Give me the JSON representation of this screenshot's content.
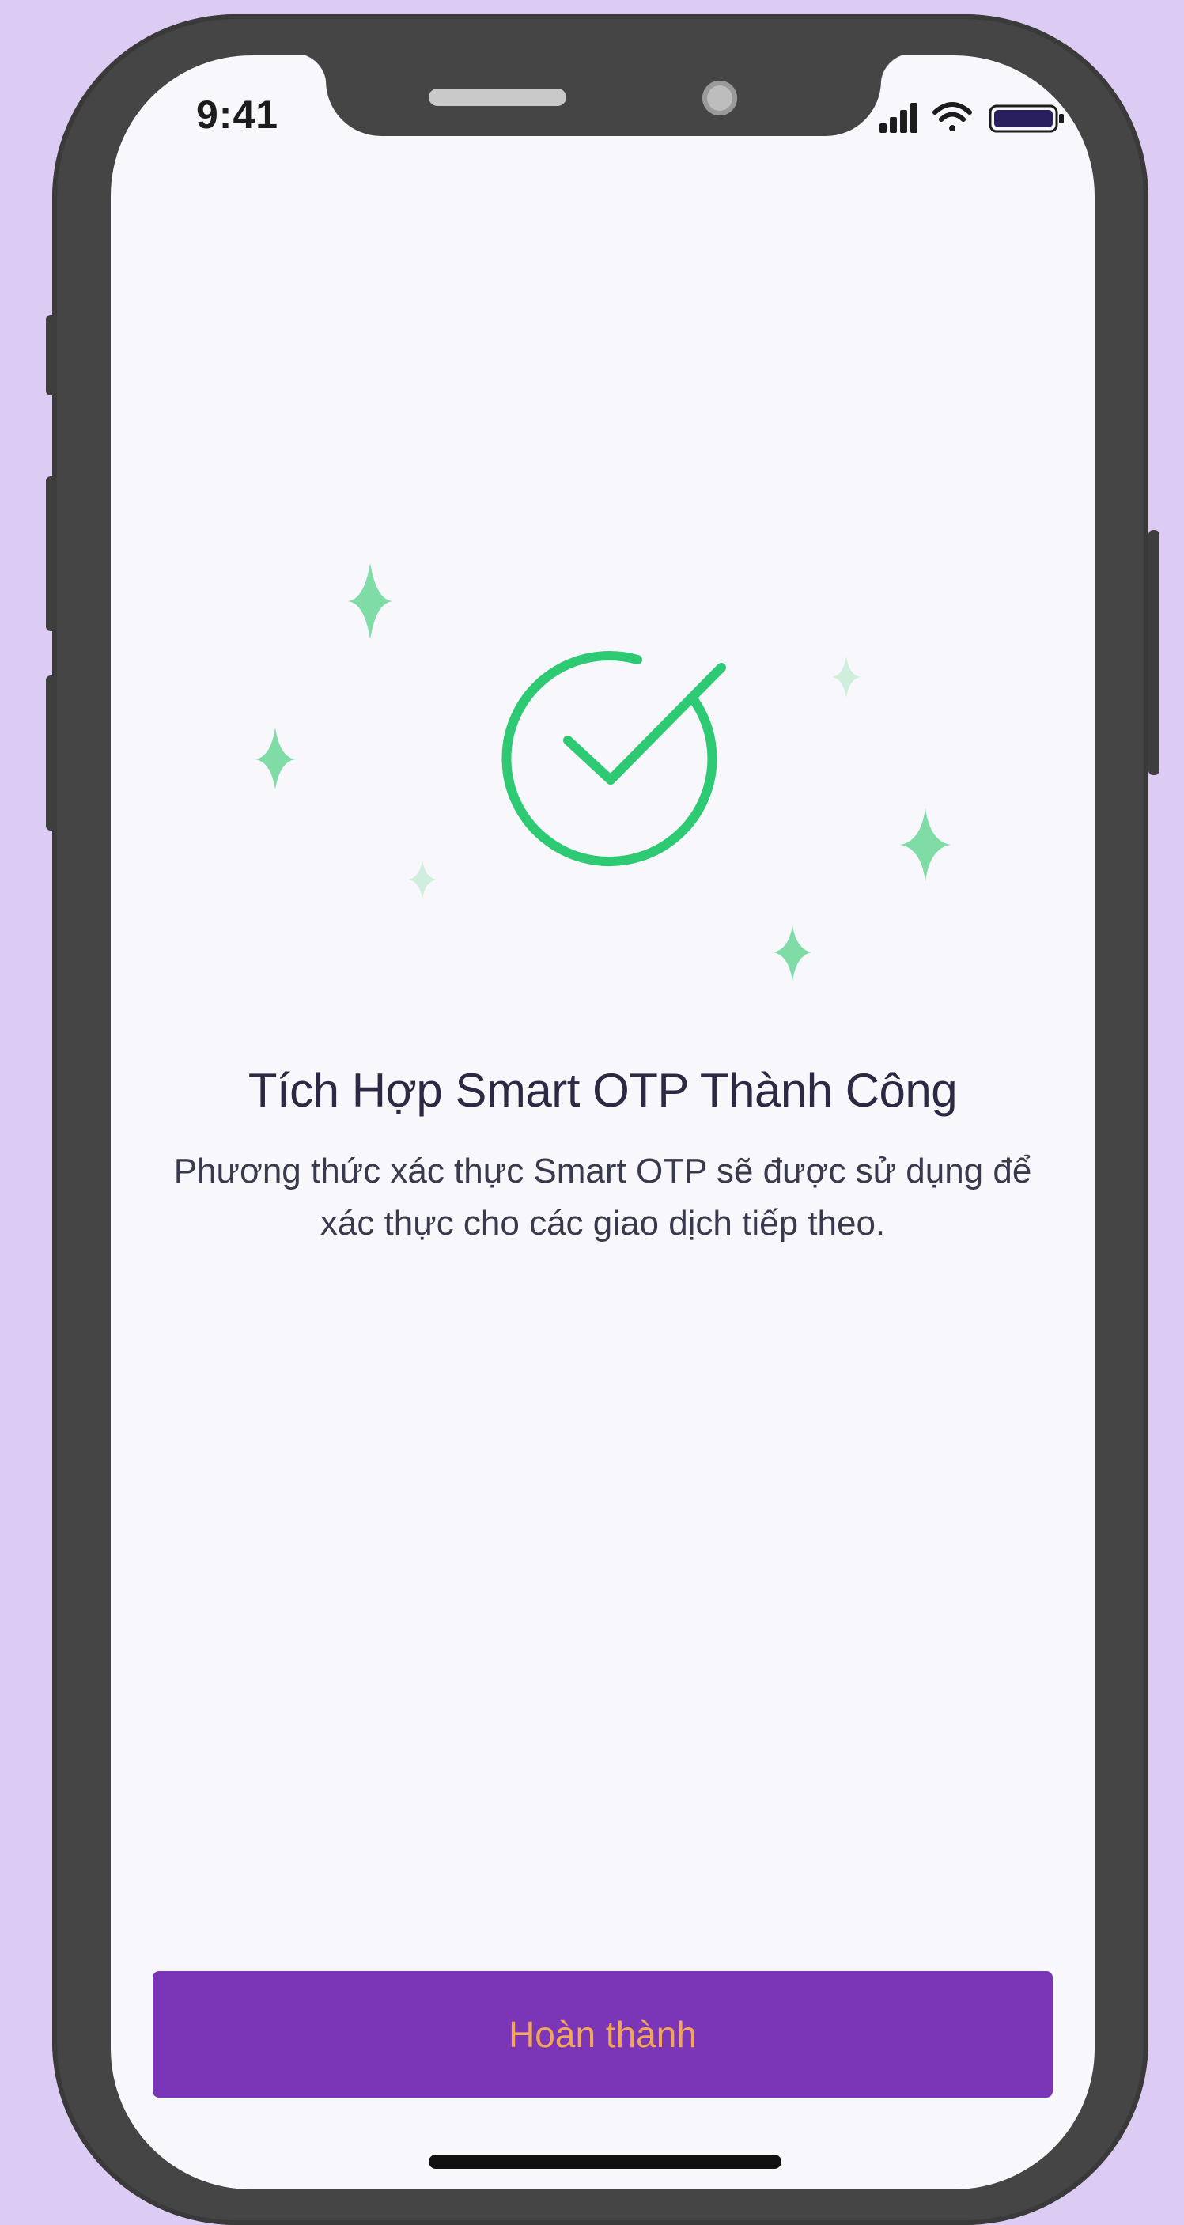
{
  "status_bar": {
    "time": "9:41",
    "icons": [
      "signal-icon",
      "wifi-icon",
      "battery-icon"
    ]
  },
  "main": {
    "title": "Tích Hợp Smart OTP Thành Công",
    "description": "Phương thức xác thực Smart OTP sẽ được sử dụng để xác thực cho các giao dịch tiếp theo.",
    "illustration_icon": "success-check-icon"
  },
  "footer": {
    "done_label": "Hoàn thành"
  },
  "colors": {
    "background": "#dccbf3",
    "screen": "#f8f7fb",
    "accent_green": "#2ec973",
    "sparkle_green": "#7fdca6",
    "button_purple": "#7b35b7",
    "button_text": "#f2a65a",
    "title_text": "#2b2944"
  }
}
